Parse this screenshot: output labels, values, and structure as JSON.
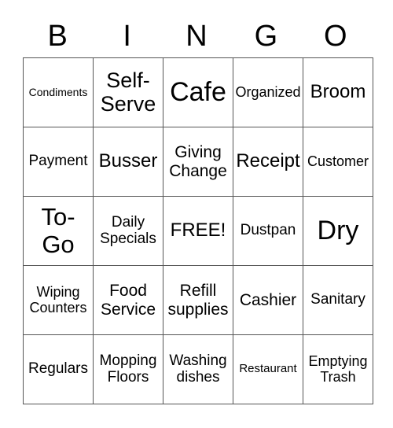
{
  "header": {
    "letters": [
      "B",
      "I",
      "N",
      "G",
      "O"
    ]
  },
  "board": {
    "rows": [
      [
        "Condiments",
        "Self-\nServe",
        "Cafe",
        "Organized",
        "Broom"
      ],
      [
        "Payment",
        "Busser",
        "Giving\nChange",
        "Receipt",
        "Customer"
      ],
      [
        "To-\nGo",
        "Daily\nSpecials",
        "FREE!",
        "Dustpan",
        "Dry"
      ],
      [
        "Wiping\nCounters",
        "Food\nService",
        "Refill\nsupplies",
        "Cashier",
        "Sanitary"
      ],
      [
        "Regulars",
        "Mopping\nFloors",
        "Washing\ndishes",
        "Restaurant",
        "Emptying\nTrash"
      ]
    ]
  }
}
